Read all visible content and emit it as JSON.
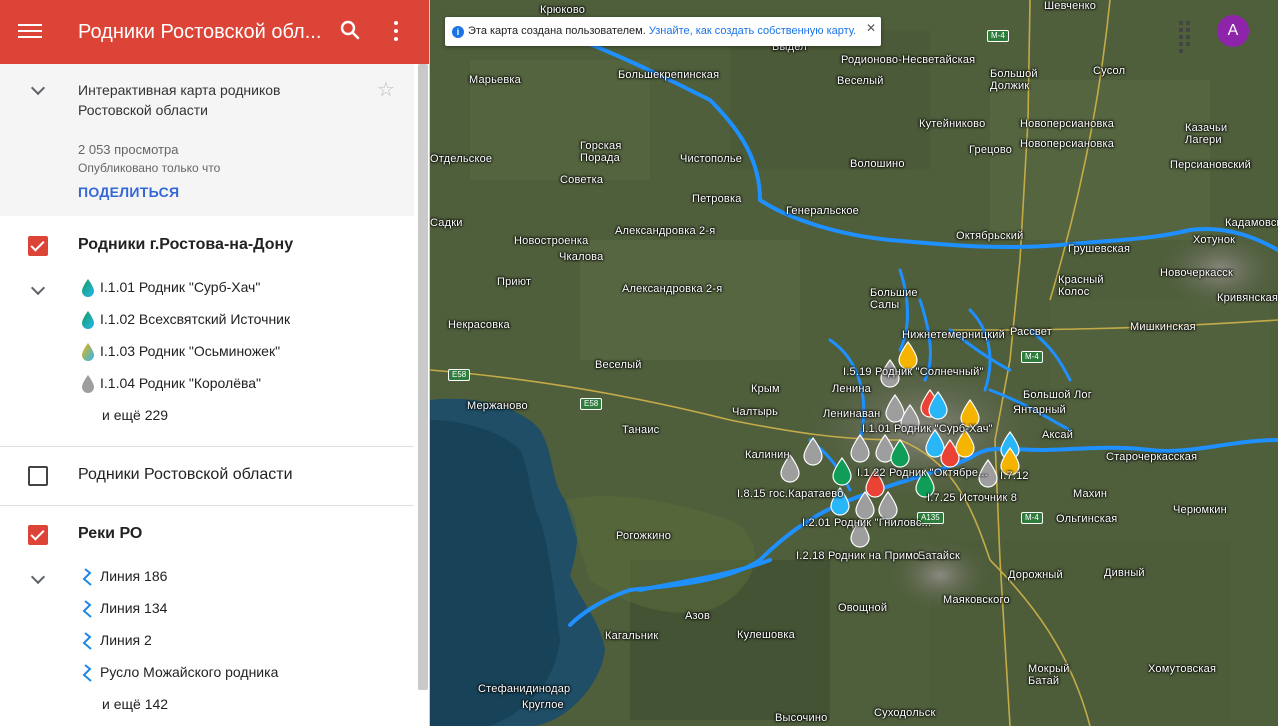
{
  "app": {
    "title": "Родники Ростовской обл...",
    "icons": {
      "menu": "menu-icon",
      "search": "search-icon",
      "more": "more-vert-icon",
      "star": "star-outline-icon"
    },
    "colors": {
      "topbar": "#db4437",
      "accent_link": "#3367d6",
      "checkbox_on": "#db4437"
    }
  },
  "info": {
    "description": "Интерактивная карта родников Ростовской области",
    "views": "2 053 просмотра",
    "published": "Опубликовано только что",
    "share_label": "ПОДЕЛИТЬСЯ"
  },
  "layers": [
    {
      "title": "Родники г.Ростова-на-Дону",
      "checked": true,
      "items": [
        {
          "label": "I.1.01 Родник \"Сурб-Хач\"",
          "icon": "drop-icon",
          "color": "#0f9d58"
        },
        {
          "label": "I.1.02 Всехсвятский Источник",
          "icon": "drop-icon",
          "color": "#0f9d58"
        },
        {
          "label": "I.1.03 Родник \"Осьминожек\"",
          "icon": "drop-icon",
          "color": "#f4b400"
        },
        {
          "label": "I.1.04 Родник \"Королёва\"",
          "icon": "drop-icon",
          "color": "#9e9e9e"
        }
      ],
      "more": "и ещё 229"
    },
    {
      "title": "Родники Ростовской области",
      "checked": false
    },
    {
      "title": "Реки РО",
      "checked": true,
      "items": [
        {
          "label": "Линия 186",
          "icon": "line-icon"
        },
        {
          "label": "Линия 134",
          "icon": "line-icon"
        },
        {
          "label": "Линия 2",
          "icon": "line-icon"
        },
        {
          "label": "Русло Можайского родника",
          "icon": "line-icon"
        }
      ],
      "more": "и ещё 142"
    }
  ],
  "map": {
    "banner": {
      "text": "Эта карта создана пользователем.",
      "link": "Узнайте, как создать собственную карту.",
      "icon": "info-icon"
    },
    "avatar_letter": "A",
    "avatar_color": "#8e24aa",
    "river_color": "#1e90ff",
    "places": [
      "Крюково",
      "Шевченко",
      "Выдел",
      "Родионово-Несветайская",
      "Большой Должик",
      "Сусол",
      "Марьевка",
      "Большекрепинская",
      "Веселый",
      "Кутейниково",
      "Новоперсиановка",
      "Казачьи Лагери",
      "Горская Порада",
      "Чистополье",
      "Волошино",
      "Грецово",
      "Новоперсиановка",
      "Персиановский",
      "Отдельское",
      "Советка",
      "Петровка",
      "Генеральское",
      "Кадамовский",
      "Садки",
      "Новостроенка",
      "Александровка 2-я",
      "Октябрьский",
      "Грушевская",
      "Хотунок",
      "Чкалова",
      "Новочеркасск",
      "Приют",
      "Александровка 2-я",
      "Большие Салы",
      "Красный Колос",
      "Кривянская",
      "Некрасовка",
      "Нижнетемерницкий",
      "Рассвет",
      "Мишкинская",
      "Веселый",
      "Крым",
      "Ленина",
      "Большой Лог",
      "Мержаново",
      "Чалтырь",
      "Ленинаван",
      "Янтарный",
      "Танаис",
      "Аксай",
      "Калинин",
      "Старочеркасская",
      "Махин",
      "Ольгинская",
      "Черюмкин",
      "Рогожкино",
      "Батайск",
      "Дорожный",
      "Дивный",
      "Овощной",
      "Маяковского",
      "Азов",
      "Кагальник",
      "Кулешовка",
      "Мокрый Батай",
      "Хомутовская",
      "Стефанидинодар",
      "Круглое",
      "Высочино",
      "Суходольск",
      "М-4",
      "E58",
      "E58",
      "A135",
      "М-4",
      "М-4"
    ],
    "markers": [
      "I.5.19 Родник \"Солнечный\"",
      "I.1.01 Родник \"Сурб-Хач\"",
      "I.1.22 Родник \"Октябре...",
      "I.7.25 Источник 8",
      "I.7.12",
      "I.8.15 гос.Каратаево",
      "I.2.01 Родник \"Гниловс...",
      "I.2.18 Родник на Примо..."
    ]
  }
}
